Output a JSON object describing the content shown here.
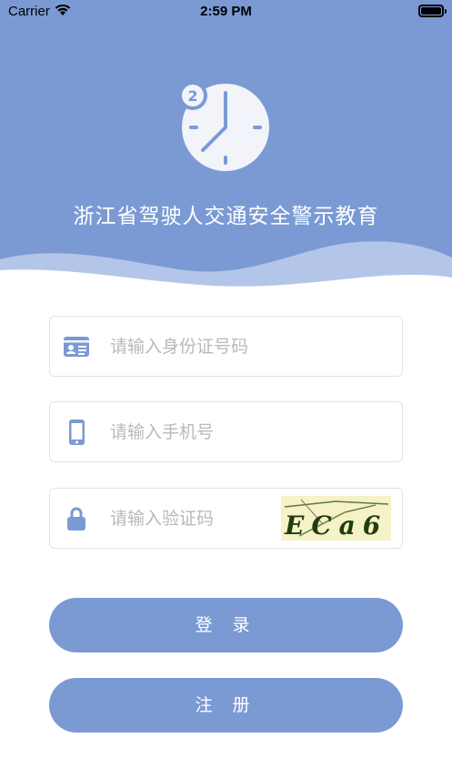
{
  "status_bar": {
    "carrier": "Carrier",
    "time": "2:59 PM"
  },
  "header": {
    "badge_number": "2",
    "title": "浙江省驾驶人交通安全警示教育"
  },
  "form": {
    "id_card": {
      "placeholder": "请输入身份证号码",
      "value": "",
      "icon": "id-card-icon"
    },
    "phone": {
      "placeholder": "请输入手机号",
      "value": "",
      "icon": "phone-icon"
    },
    "captcha": {
      "placeholder": "请输入验证码",
      "value": "",
      "icon": "lock-icon",
      "captcha_text": "ECa6"
    }
  },
  "buttons": {
    "login": "登 录",
    "register": "注 册"
  },
  "colors": {
    "primary": "#7b9ad4",
    "wave_light": "#b9caeb",
    "placeholder": "#b9b9b9",
    "border": "#e3e3e3"
  }
}
